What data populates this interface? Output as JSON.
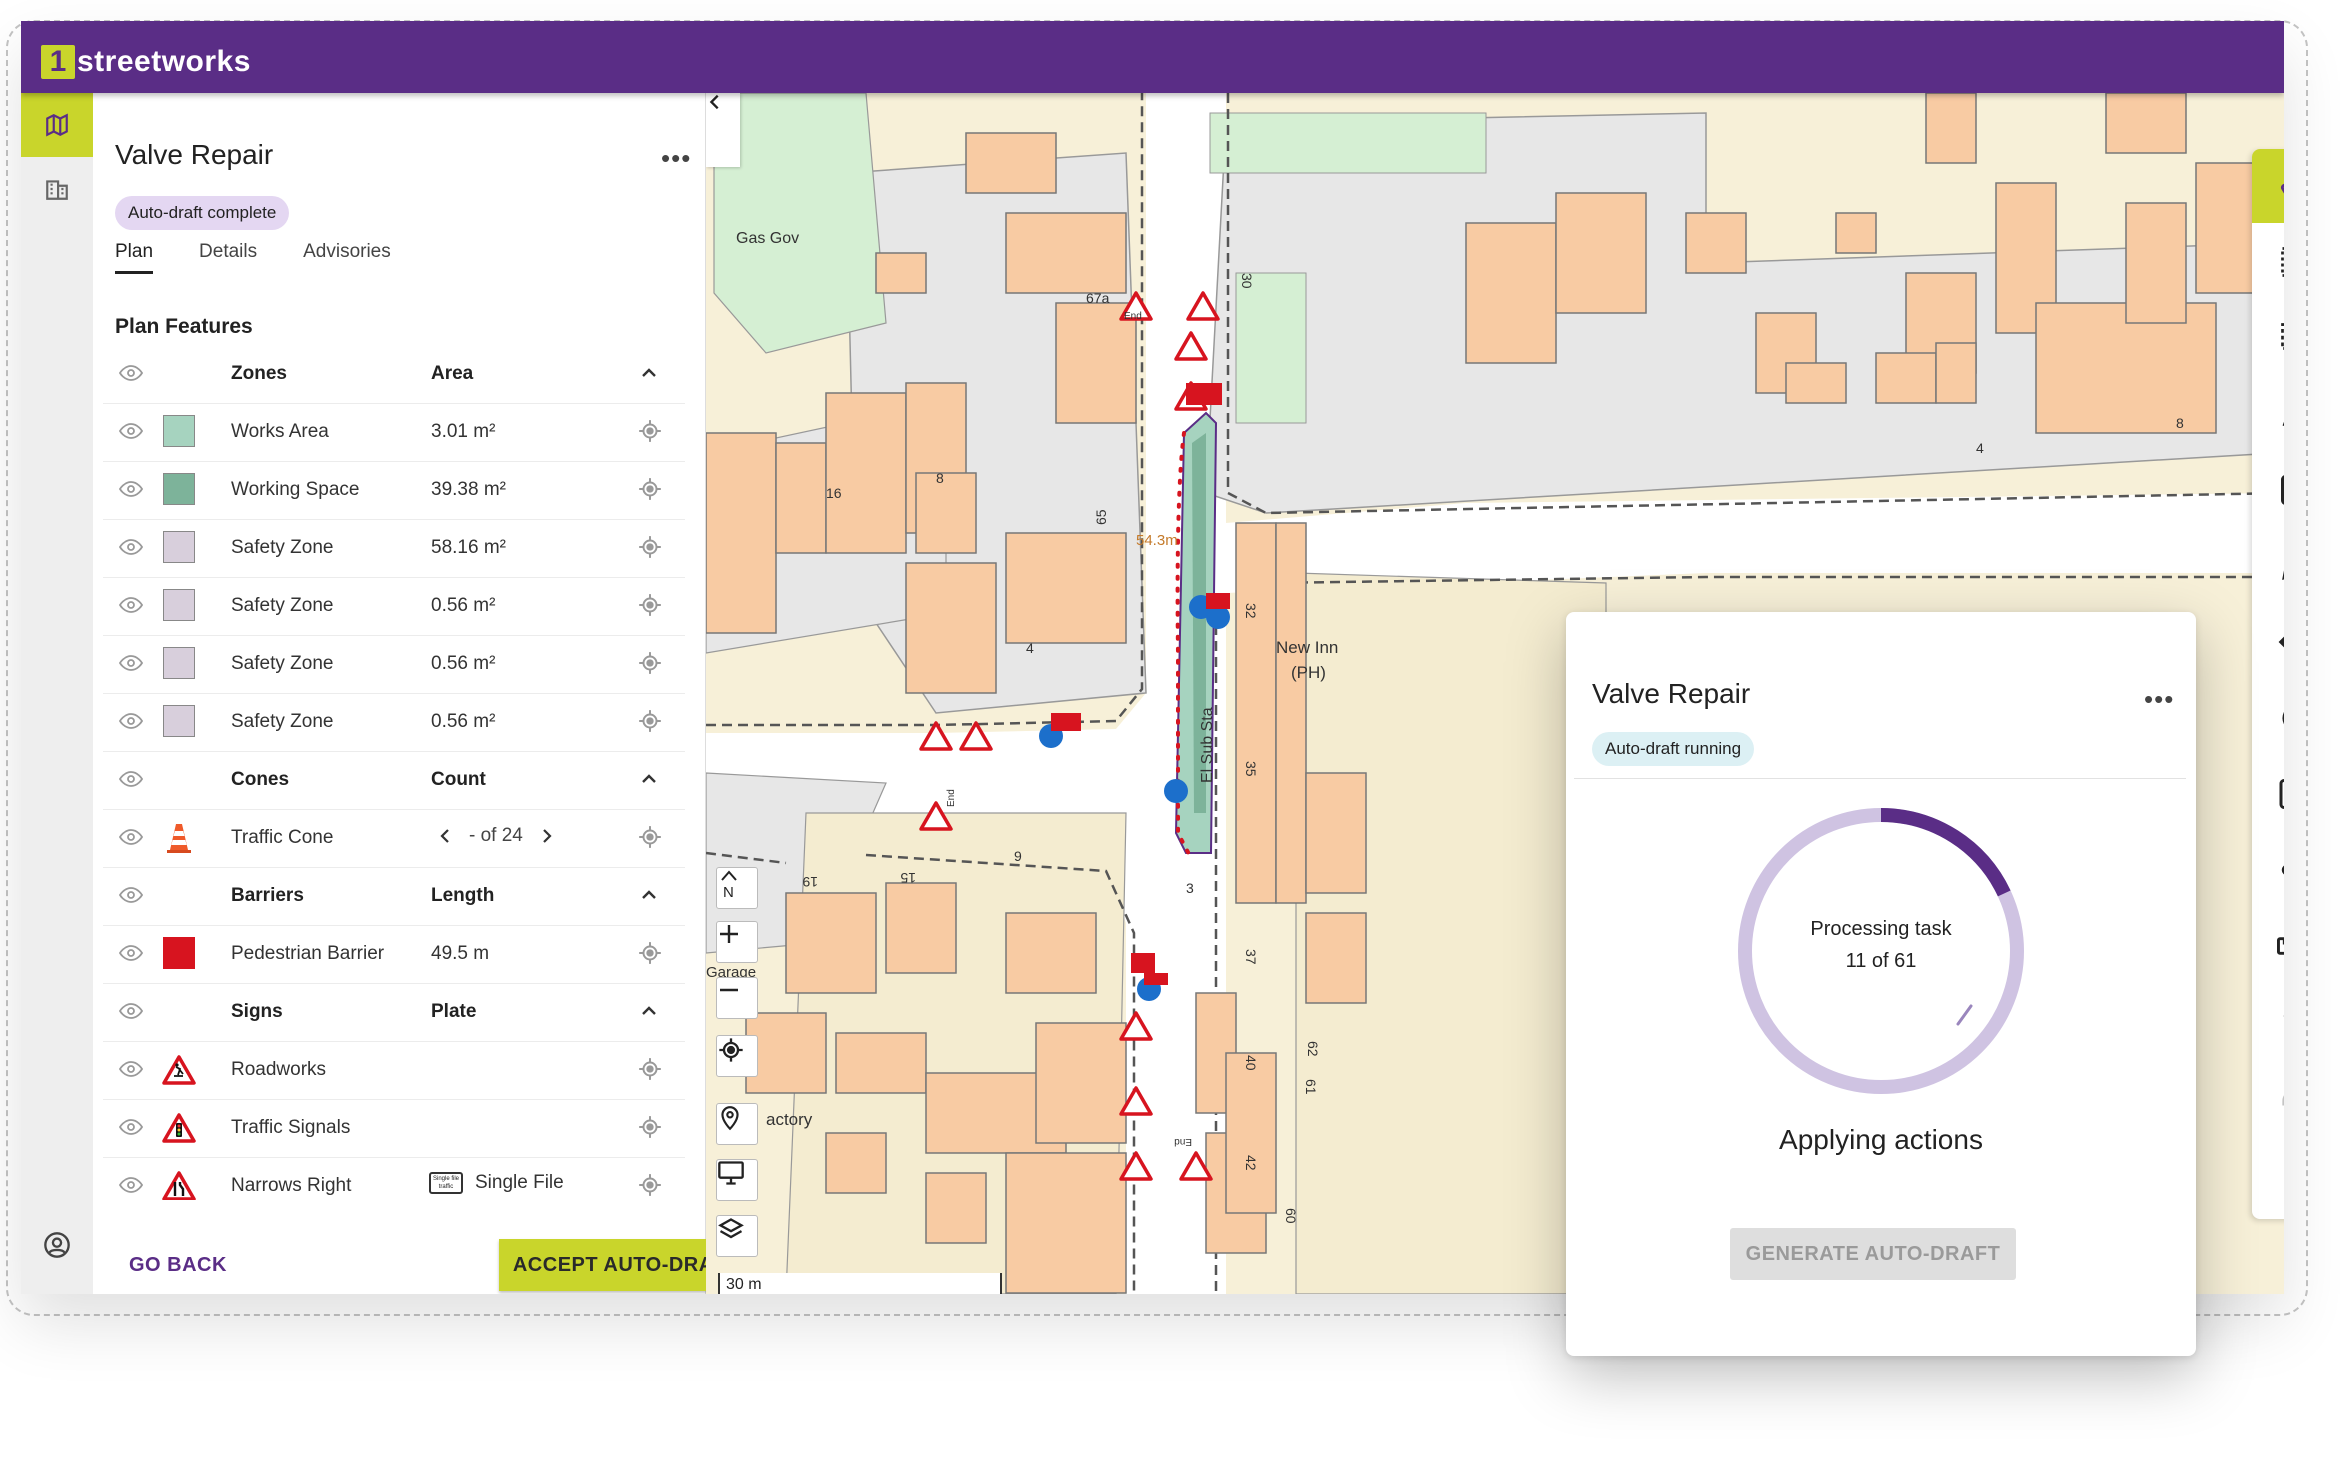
{
  "app": {
    "logo_mark": "1",
    "logo_text": "streetworks"
  },
  "panel": {
    "title": "Valve Repair",
    "more": "•••",
    "status": "Auto-draft complete",
    "tabs": [
      "Plan",
      "Details",
      "Advisories"
    ],
    "section": "Plan Features",
    "groups": {
      "zones": {
        "label": "Zones",
        "col": "Area"
      },
      "cones": {
        "label": "Cones",
        "col": "Count"
      },
      "barriers": {
        "label": "Barriers",
        "col": "Length"
      },
      "signs": {
        "label": "Signs",
        "col": "Plate"
      }
    },
    "zones": [
      {
        "name": "Works Area",
        "value": "3.01 m²",
        "color": "#a6d3bf"
      },
      {
        "name": "Working Space",
        "value": "39.38 m²",
        "color": "#7db39a"
      },
      {
        "name": "Safety Zone",
        "value": "58.16 m²",
        "color": "#d8cfdc"
      },
      {
        "name": "Safety Zone",
        "value": "0.56 m²",
        "color": "#d8cfdc"
      },
      {
        "name": "Safety Zone",
        "value": "0.56 m²",
        "color": "#d8cfdc"
      },
      {
        "name": "Safety Zone",
        "value": "0.56 m²",
        "color": "#d8cfdc"
      }
    ],
    "cones": [
      {
        "name": "Traffic Cone",
        "value": "- of 24"
      }
    ],
    "barriers": [
      {
        "name": "Pedestrian Barrier",
        "value": "49.5 m",
        "color": "#d7141f"
      }
    ],
    "signs": [
      {
        "name": "Roadworks",
        "value": ""
      },
      {
        "name": "Traffic Signals",
        "value": ""
      },
      {
        "name": "Narrows Right",
        "value": "Single File",
        "plate_text": "Single file traffic"
      }
    ],
    "go_back": "GO BACK",
    "accept": "ACCEPT AUTO-DRAFT"
  },
  "map": {
    "labels": {
      "gas_gov": "Gas Gov",
      "new_inn_1": "New Inn",
      "new_inn_2": "(PH)",
      "factory": "actory",
      "garage": "Garage",
      "sub_sta": "El Sub Sta",
      "bm": "54.3m",
      "n16": "16",
      "n8a": "8",
      "n4a": "4",
      "n65": "65",
      "n67a": "67a",
      "n30": "30",
      "n32": "32",
      "n35": "35",
      "n4b": "4",
      "n8b": "8",
      "n19": "19",
      "n15": "15",
      "n9": "9",
      "n3": "3",
      "n62": "62",
      "n61": "61",
      "n60": "60",
      "n37": "37",
      "n40": "40",
      "n42": "42",
      "end1": "End",
      "end2": "End",
      "end3": "End"
    },
    "north": "N",
    "scale": "30 m",
    "brand": "#5a2d86",
    "accent": "#c9d52b"
  },
  "dialog": {
    "title": "Valve Repair",
    "more": "•••",
    "status": "Auto-draft running",
    "progress_line1": "Processing task",
    "progress_line2": "11 of 61",
    "progress_done": 11,
    "progress_total": 61,
    "state": "Applying actions",
    "generate": "GENERATE AUTO-DRAFT"
  },
  "toolbar": [
    "pointer-tool",
    "select-box-tool",
    "select-area-tool",
    "freehand-tool",
    "add-tool",
    "edit-tool",
    "move-tool",
    "rotate-tool",
    "resize-tool",
    "connect-tool",
    "measure-tool",
    "undo-tool",
    "redo-tool",
    "delete-tool"
  ]
}
